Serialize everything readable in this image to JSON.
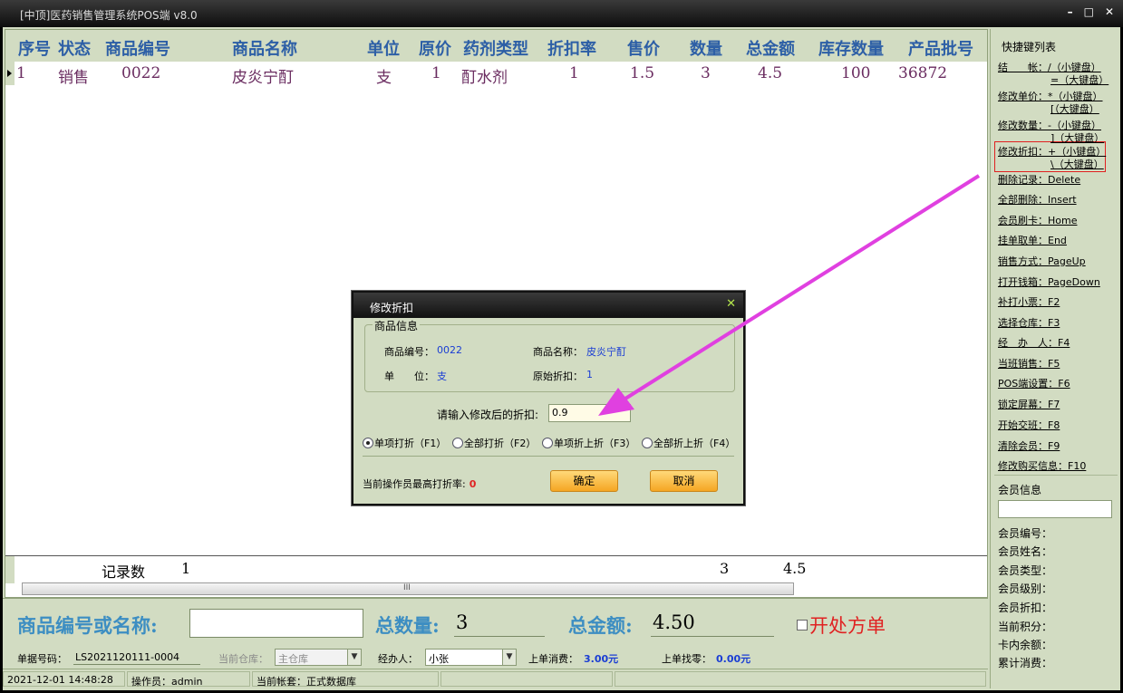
{
  "window": {
    "title": "[中顶]医药销售管理系统POS端 v8.0",
    "minimize_icon": "minimize-icon",
    "maximize_icon": "maximize-icon",
    "close_icon": "close-icon"
  },
  "grid": {
    "columns": [
      "序号",
      "状态",
      "商品编号",
      "商品名称",
      "单位",
      "原价",
      "药剂类型",
      "折扣率",
      "售价",
      "数量",
      "总金额",
      "库存数量",
      "产品批号"
    ],
    "rows": [
      [
        "1",
        "销售",
        "0022",
        "皮炎宁酊",
        "支",
        "1",
        "酊水剂",
        "1",
        "1.5",
        "3",
        "4.5",
        "100",
        "36872"
      ]
    ],
    "footer": {
      "label": "记录数",
      "count": "1",
      "qty": "3",
      "total": "4.5"
    },
    "scroll_grip": "III"
  },
  "sidebar": {
    "title": "快捷键列表",
    "shortcuts": [
      {
        "label": "结　　帐：/（小键盘）",
        "line2": "=（大键盘）"
      },
      {
        "label": "修改单价：*（小键盘）",
        "line2": "[（大键盘）"
      },
      {
        "label": "修改数量：-（小键盘）",
        "line2": "]（大键盘）"
      },
      {
        "label": "修改折扣：+（小键盘）",
        "line2": "\\（大键盘）"
      },
      {
        "label": "删除记录：Delete"
      },
      {
        "label": "全部删除：Insert"
      },
      {
        "label": "会员刷卡：Home"
      },
      {
        "label": "挂单取单：End"
      },
      {
        "label": "销售方式：PageUp"
      },
      {
        "label": "打开钱箱：PageDown"
      },
      {
        "label": "补打小票：F2"
      },
      {
        "label": "选择仓库：F3"
      },
      {
        "label": "经　办　人：F4"
      },
      {
        "label": "当班销售：F5"
      },
      {
        "label": "POS端设置：F6"
      },
      {
        "label": "锁定屏幕：F7"
      },
      {
        "label": "开始交班：F8"
      },
      {
        "label": "清除会员：F9"
      },
      {
        "label": "修改购买信息：F10"
      }
    ],
    "member": {
      "title": "会员信息",
      "fields": [
        "会员编号：",
        "会员姓名：",
        "会员类型：",
        "会员级别：",
        "会员折扣：",
        "当前积分：",
        "卡内余额：",
        "累计消费："
      ]
    }
  },
  "bottom": {
    "search_label": "商品编号或名称:",
    "search_value": "",
    "qty_label": "总数量:",
    "qty_value": "3",
    "amount_label": "总金额:",
    "amount_value": "4.50",
    "rx_label": "开处方单"
  },
  "info": {
    "bill_label": "单据号码：",
    "bill_value": "LS2021120111-0004",
    "warehouse_label": "当前仓库：",
    "warehouse_value": "主仓库",
    "handler_label": "经办人：",
    "handler_value": "小张",
    "last_spend_label": "上单消费：",
    "last_spend_value": "3.00元",
    "last_change_label": "上单找零：",
    "last_change_value": "0.00元"
  },
  "status": {
    "datetime": "2021-12-01 14:48:28",
    "operator_label": "操作员：",
    "operator_value": "admin",
    "account_label": "当前帐套：",
    "account_value": "正式数据库"
  },
  "dialog": {
    "title": "修改折扣",
    "close_icon": "close-icon",
    "group_title": "商品信息",
    "code_label": "商品编号：",
    "code_value": "0022",
    "name_label": "商品名称：",
    "name_value": "皮炎宁酊",
    "unit_label": "单　　位：",
    "unit_value": "支",
    "orig_label": "原始折扣：",
    "orig_value": "1",
    "prompt": "请输入修改后的折扣:",
    "input_value": "0.9",
    "radios": [
      "单项打折（F1）",
      "全部打折（F2）",
      "单项折上折（F3）",
      "全部折上折（F4）"
    ],
    "selected_radio": 0,
    "max_label": "当前操作员最高打折率:",
    "max_value": "0",
    "ok": "确定",
    "cancel": "取消"
  },
  "colors": {
    "header_blue": "#2d5fa6",
    "row_text": "#6a2c60",
    "accent_red": "#e02222",
    "frame": "#d2dcc2",
    "arrow": "#e040e0"
  }
}
